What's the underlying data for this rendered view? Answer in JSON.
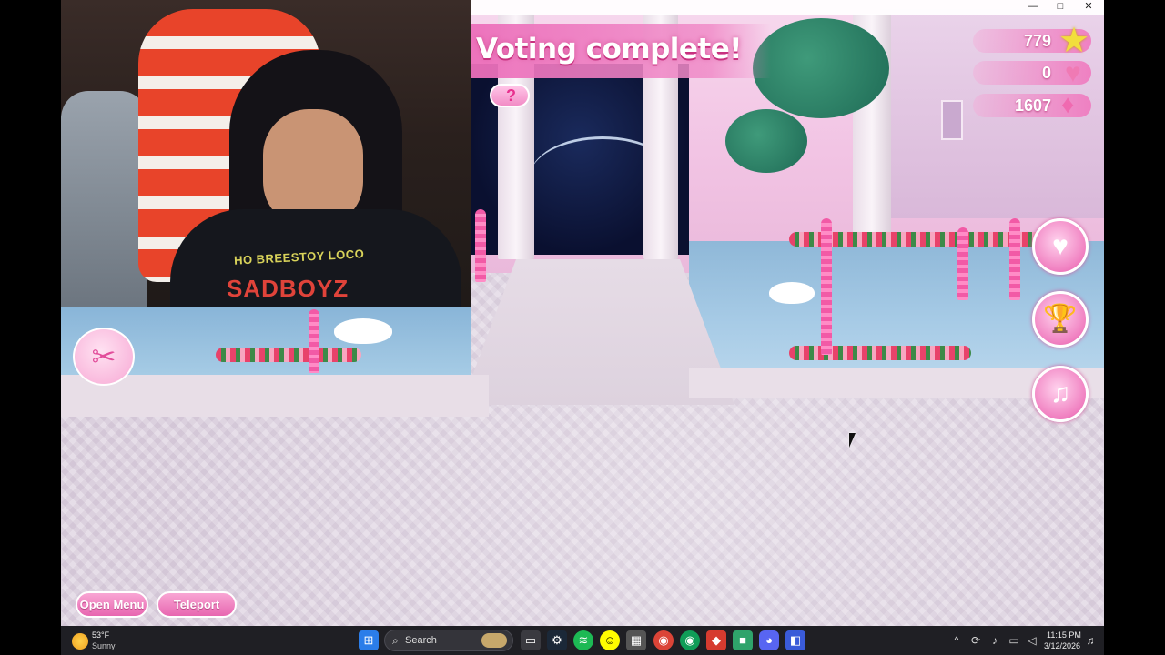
{
  "window": {
    "minimize_icon": "minimize-icon",
    "maximize_icon": "maximize-icon",
    "close_icon": "close-icon",
    "minimize_glyph": "—",
    "maximize_glyph": "□",
    "close_glyph": "✕"
  },
  "hud": {
    "banner_text": "Voting complete!",
    "stars": "779",
    "hearts": "0",
    "gems": "1607",
    "open_menu_label": "Open Menu",
    "teleport_label": "Teleport",
    "icons": [
      "star-icon",
      "heart-icon",
      "gem-icon",
      "help-icon",
      "love-game-icon",
      "trophy-icon",
      "dance-emote-icon",
      "outfit-icon"
    ]
  },
  "webcam": {
    "shirt_text_top": "HO BREESTOY LOCO",
    "shirt_text_bottom": "SADBOYZ"
  },
  "taskbar": {
    "weather_temp": "53°F",
    "weather_condition": "Sunny",
    "search_placeholder": "Search",
    "clock_time": "11:15 PM",
    "clock_date": "3/12/2026",
    "pinned_apps": [
      "windows-start",
      "search",
      "file-explorer",
      "steam",
      "spotify",
      "snapchat",
      "calculator",
      "chrome",
      "chrome-profile",
      "app-red",
      "app-green",
      "discord",
      "roblox"
    ]
  },
  "colors": {
    "accent_pink": "#e766b0",
    "banner_pink": "#ec6eba",
    "taskbar_bg": "#1f1f24"
  }
}
